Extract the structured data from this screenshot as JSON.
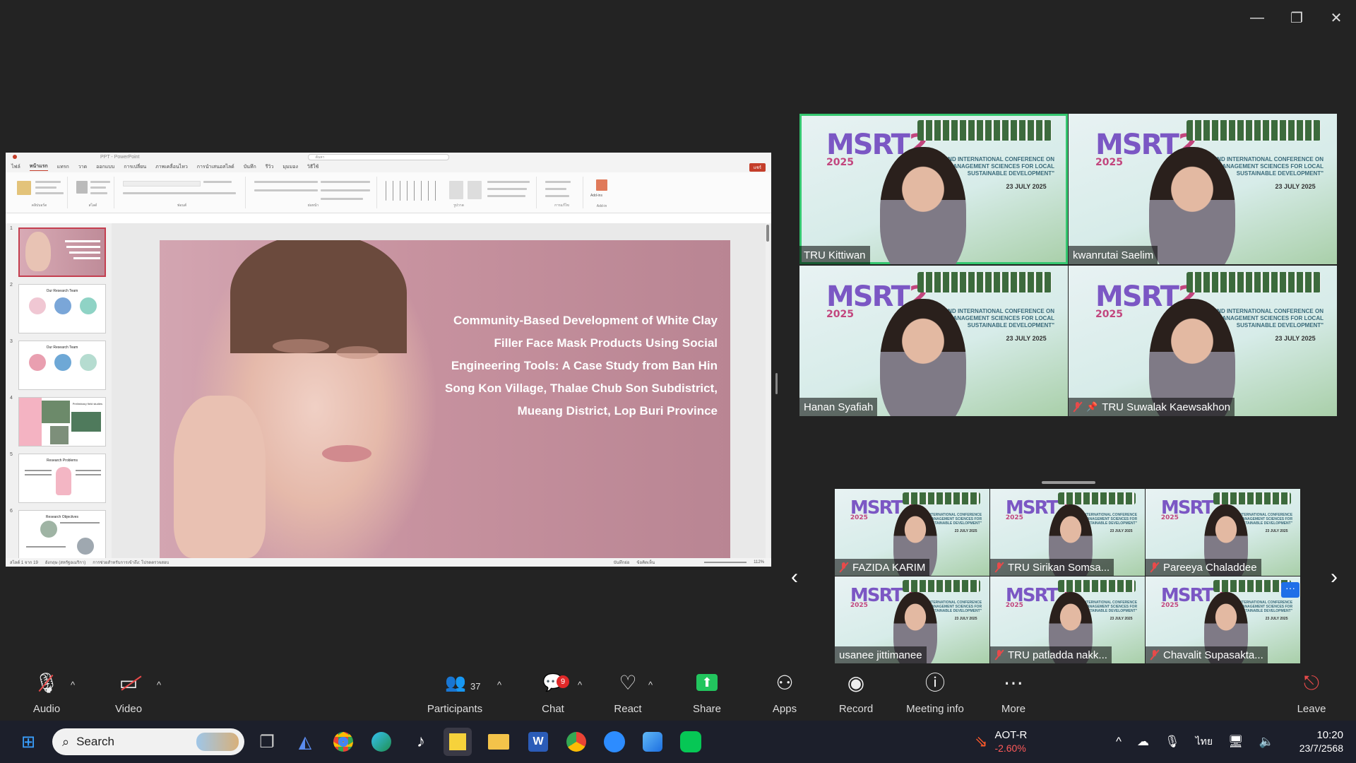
{
  "presentation": {
    "app_title": "PPT - PowerPoint",
    "search_placeholder": "ค้นหา",
    "share_button": "แชร์",
    "ribbon_tabs": [
      "ไฟล์",
      "หน้าแรก",
      "แทรก",
      "วาด",
      "ออกแบบ",
      "การเปลี่ยน",
      "ภาพเคลื่อนไหว",
      "การนำเสนอสไลด์",
      "บันทึก",
      "รีวิว",
      "มุมมอง",
      "วิธีใช้"
    ],
    "ribbon_groups": [
      "คลิปบอร์ด",
      "สไลด์",
      "ฟอนต์",
      "ย่อหน้า",
      "รูปวาด",
      "การแก้ไข",
      "Add-in"
    ],
    "addins_label": "Add-ins",
    "slide_title": "Community-Based Development of White Clay Filler Face Mask Products Using Social Engineering Tools: A Case Study from Ban Hin Song Kon Village, Thalae Chub Son Subdistrict, Mueang District, Lop Buri Province",
    "thumbnails": [
      {
        "num": "1",
        "title": ""
      },
      {
        "num": "2",
        "title": "Our Research Team"
      },
      {
        "num": "3",
        "title": "Our Research Team"
      },
      {
        "num": "4",
        "title": "Preliminary field studies"
      },
      {
        "num": "5",
        "title": "Research Problems"
      },
      {
        "num": "6",
        "title": "Research Objectives"
      }
    ],
    "status_left": "สไลด์ 1 จาก 19",
    "status_lang": "อังกฤษ (สหรัฐอเมริกา)",
    "status_access": "การช่วยสำหรับการเข้าถึง: โปรดตรวจสอบ",
    "status_notes": "บันทึกย่อ",
    "status_comments": "ข้อคิดเห็น",
    "zoom_level": "112%"
  },
  "gallery_top": [
    {
      "name": "TRU Kittiwan",
      "muted": false,
      "pinned": false,
      "active": true
    },
    {
      "name": "kwanrutai Saelim",
      "muted": false,
      "pinned": false,
      "active": false
    },
    {
      "name": "Hanan Syafiah",
      "muted": false,
      "pinned": false,
      "active": false
    },
    {
      "name": "TRU Suwalak Kaewsakhon",
      "muted": true,
      "pinned": true,
      "active": false
    }
  ],
  "gallery_bottom": [
    {
      "name": "FAZIDA KARIM",
      "muted": true
    },
    {
      "name": "TRU Sirikan Somsa...",
      "muted": true
    },
    {
      "name": "Pareeya Chaladdee",
      "muted": true
    },
    {
      "name": "usanee jittimanee",
      "muted": false
    },
    {
      "name": "TRU patladda nakk...",
      "muted": true
    },
    {
      "name": "Chavalit Supasakta...",
      "muted": true
    }
  ],
  "tile_background": {
    "logo": "MSRT",
    "logo_num": "2",
    "logo_year": "2025",
    "conference": "THE 2ND INTERNATIONAL CONFERENCE ON \"MANAGEMENT SCIENCES FOR LOCAL SUSTAINABLE DEVELOPMENT\"",
    "date": "23 JULY 2025"
  },
  "toolbar": {
    "audio": "Audio",
    "video": "Video",
    "participants": "Participants",
    "participants_count": "37",
    "chat": "Chat",
    "chat_badge": "9",
    "react": "React",
    "share": "Share",
    "apps": "Apps",
    "record": "Record",
    "meeting_info": "Meeting info",
    "more": "More",
    "leave": "Leave"
  },
  "taskbar": {
    "search": "Search",
    "stock_name": "AOT-R",
    "stock_change": "-2.60%",
    "lang": "ไทย",
    "time": "10:20",
    "date": "23/7/2568"
  },
  "colors": {
    "active_speaker": "#35c770",
    "muted": "#e84a4a",
    "share_green": "#22c55e",
    "stock_down": "#ff5a5a"
  }
}
